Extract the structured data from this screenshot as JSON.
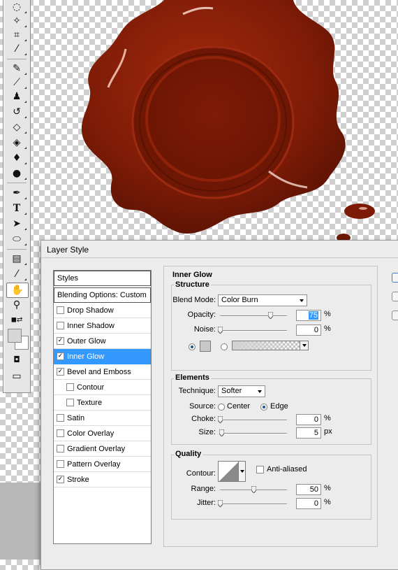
{
  "dialog": {
    "title": "Layer Style",
    "styles_panel": {
      "header": "Styles",
      "blending": "Blending Options: Custom",
      "items": [
        {
          "label": "Drop Shadow",
          "checked": false,
          "indent": false,
          "selected": false
        },
        {
          "label": "Inner Shadow",
          "checked": false,
          "indent": false,
          "selected": false
        },
        {
          "label": "Outer Glow",
          "checked": true,
          "indent": false,
          "selected": false
        },
        {
          "label": "Inner Glow",
          "checked": true,
          "indent": false,
          "selected": true
        },
        {
          "label": "Bevel and Emboss",
          "checked": true,
          "indent": false,
          "selected": false
        },
        {
          "label": "Contour",
          "checked": false,
          "indent": true,
          "selected": false
        },
        {
          "label": "Texture",
          "checked": false,
          "indent": true,
          "selected": false
        },
        {
          "label": "Satin",
          "checked": false,
          "indent": false,
          "selected": false
        },
        {
          "label": "Color Overlay",
          "checked": false,
          "indent": false,
          "selected": false
        },
        {
          "label": "Gradient Overlay",
          "checked": false,
          "indent": false,
          "selected": false
        },
        {
          "label": "Pattern Overlay",
          "checked": false,
          "indent": false,
          "selected": false
        },
        {
          "label": "Stroke",
          "checked": true,
          "indent": false,
          "selected": false
        }
      ]
    },
    "inner_glow": {
      "section_title": "Inner Glow",
      "structure": {
        "title": "Structure",
        "blend_mode_label": "Blend Mode:",
        "blend_mode_value": "Color Burn",
        "opacity_label": "Opacity:",
        "opacity_value": "75",
        "opacity_unit": "%",
        "opacity_fraction": 0.75,
        "noise_label": "Noise:",
        "noise_value": "0",
        "noise_unit": "%",
        "noise_fraction": 0.0
      },
      "elements": {
        "title": "Elements",
        "technique_label": "Technique:",
        "technique_value": "Softer",
        "source_label": "Source:",
        "source_center": "Center",
        "source_edge": "Edge",
        "source_selected": "Edge",
        "choke_label": "Choke:",
        "choke_value": "0",
        "choke_unit": "%",
        "choke_fraction": 0.0,
        "size_label": "Size:",
        "size_value": "5",
        "size_unit": "px",
        "size_fraction": 0.02
      },
      "quality": {
        "title": "Quality",
        "contour_label": "Contour:",
        "anti_aliased_label": "Anti-aliased",
        "anti_aliased_checked": false,
        "range_label": "Range:",
        "range_value": "50",
        "range_unit": "%",
        "range_fraction": 0.5,
        "jitter_label": "Jitter:",
        "jitter_value": "0",
        "jitter_unit": "%",
        "jitter_fraction": 0.0
      }
    }
  },
  "toolbar": {
    "tools": [
      "lasso-icon",
      "magic-wand-icon",
      "crop-icon",
      "eyedropper-icon",
      "healing-brush-icon",
      "brush-icon",
      "clone-stamp-icon",
      "history-brush-icon",
      "eraser-icon",
      "paint-bucket-icon",
      "blur-icon",
      "dodge-icon",
      "pen-icon",
      "type-icon",
      "path-selection-icon",
      "ellipse-icon",
      "notes-icon",
      "eyedropper-icon-2",
      "hand-icon",
      "zoom-icon"
    ]
  },
  "colors": {
    "selection_blue": "#3399ff",
    "wax_red": "#8a1a08"
  }
}
